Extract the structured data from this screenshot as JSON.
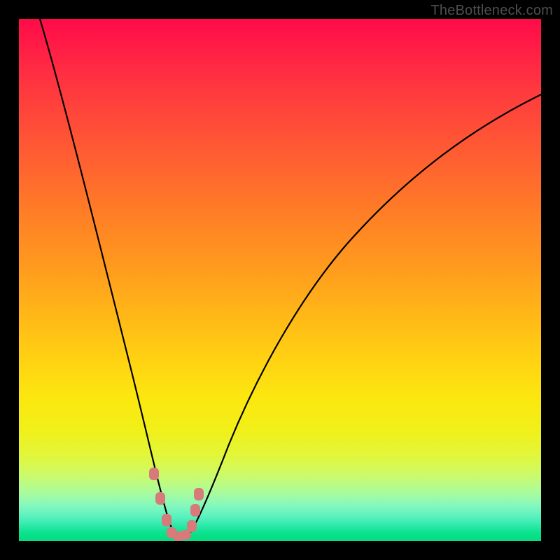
{
  "watermark": "TheBottleneck.com",
  "colors": {
    "frame": "#000000",
    "gradient_top": "#ff0b48",
    "gradient_bottom": "#06dc82",
    "curve": "#000000",
    "marker": "#d77a7a",
    "watermark_text": "#4e4e4e"
  },
  "chart_data": {
    "type": "line",
    "title": "",
    "xlabel": "",
    "ylabel": "",
    "xlim": [
      0,
      100
    ],
    "ylim": [
      0,
      100
    ],
    "legend": null,
    "note": "V-shaped bottleneck curve; y≈100 is worst (top/red), y≈0 is best (bottom/green). Values estimated from pixel positions; no axis ticks shown.",
    "series": [
      {
        "name": "bottleneck-curve",
        "x": [
          4.0,
          7.0,
          10.0,
          12.5,
          15.0,
          17.5,
          20.0,
          22.5,
          24.5,
          26.0,
          27.0,
          28.0,
          29.0,
          30.0,
          31.0,
          32.0,
          33.5,
          35.0,
          37.0,
          40.0,
          44.0,
          49.0,
          55.0,
          62.0,
          70.0,
          79.0,
          89.0,
          100.0
        ],
        "y": [
          100.0,
          89.0,
          78.0,
          69.0,
          60.0,
          51.0,
          42.0,
          33.0,
          24.0,
          16.0,
          10.0,
          5.0,
          1.5,
          0.5,
          0.5,
          1.5,
          5.0,
          10.0,
          17.0,
          26.0,
          36.0,
          46.0,
          55.0,
          63.0,
          70.0,
          76.0,
          81.0,
          85.5
        ]
      }
    ],
    "markers": [
      {
        "x": 25.7,
        "y": 13.0
      },
      {
        "x": 26.9,
        "y": 8.0
      },
      {
        "x": 28.1,
        "y": 3.7
      },
      {
        "x": 29.0,
        "y": 1.3
      },
      {
        "x": 30.2,
        "y": 0.6
      },
      {
        "x": 31.5,
        "y": 0.9
      },
      {
        "x": 32.8,
        "y": 2.6
      },
      {
        "x": 33.7,
        "y": 5.6
      },
      {
        "x": 34.3,
        "y": 8.8
      }
    ]
  }
}
